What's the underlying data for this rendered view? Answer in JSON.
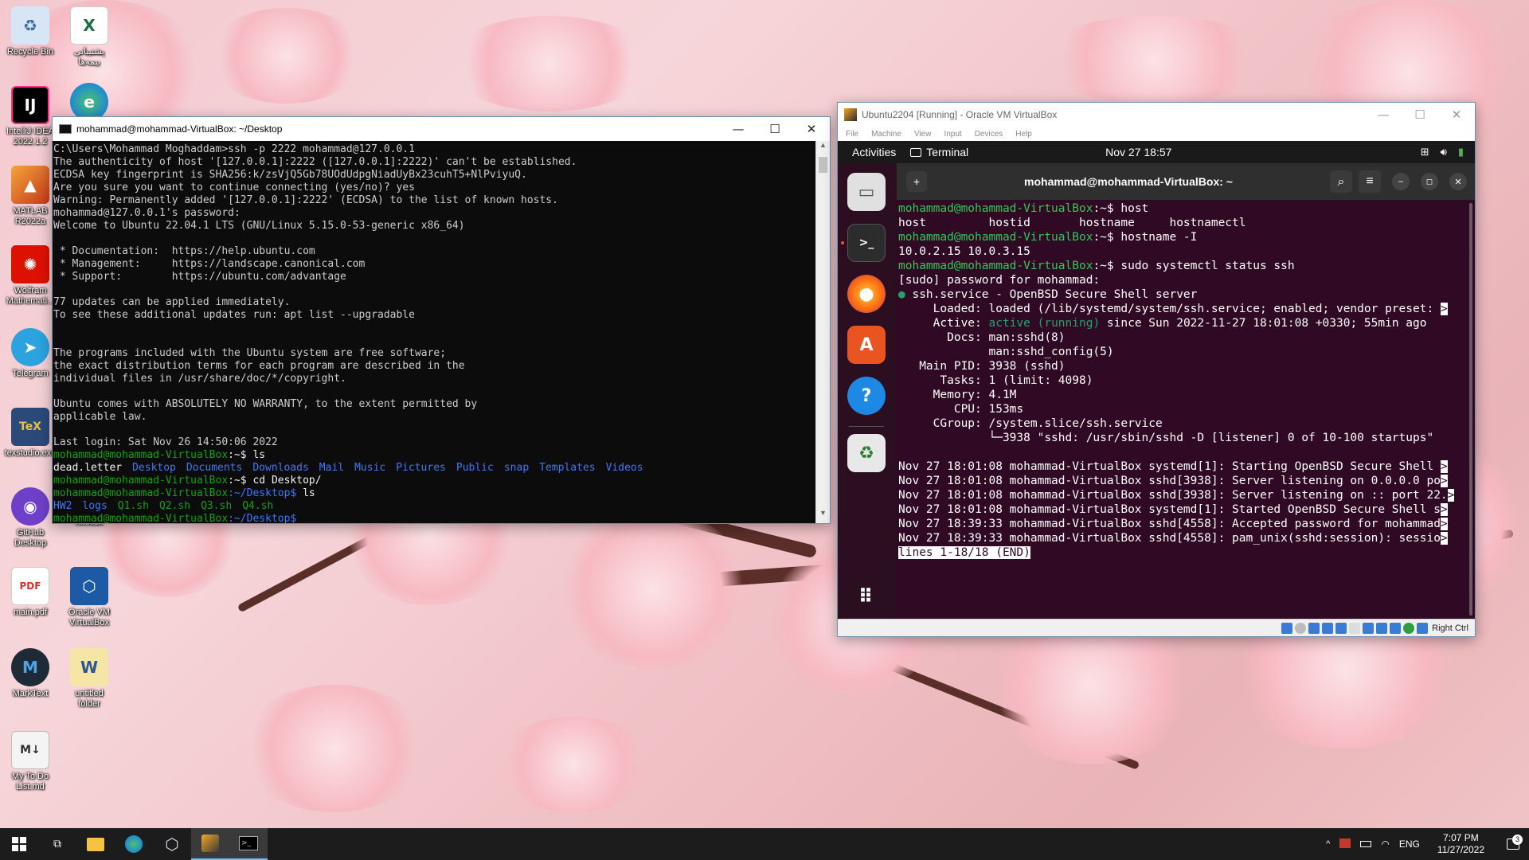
{
  "desktop": {
    "icons": [
      {
        "label": "Recycle Bin",
        "icon": "recycle-bin-icon",
        "color": "#d7e6f5"
      },
      {
        "label": "پشتیبانی\nبیمه‌ها",
        "icon": "excel-file-icon",
        "color": "#1d6f42"
      },
      {
        "label": "IntelliJ IDEA\n2022.1.2",
        "icon": "intellij-icon",
        "color": "#000000"
      },
      {
        "label": "",
        "icon": "edge-icon",
        "color": "#1f8ad2"
      },
      {
        "label": "MATLAB\nR2022a",
        "icon": "matlab-icon",
        "color": "#e16737"
      },
      {
        "label": "Wolfram\nMathemati...",
        "icon": "wolfram-icon",
        "color": "#dd1100"
      },
      {
        "label": "Telegram",
        "icon": "telegram-icon",
        "color": "#2aa3df"
      },
      {
        "label": "texstudio.exe",
        "icon": "texstudio-icon",
        "color": "#2b4a7a"
      },
      {
        "label": "GitHub\nDesktop",
        "icon": "github-desktop-icon",
        "color": "#6e40c9"
      },
      {
        "label": "nn.xlsx",
        "icon": "",
        "color": ""
      },
      {
        "label": "main.pdf",
        "icon": "pdf-file-icon",
        "color": "#ffffff"
      },
      {
        "label": "Oracle VM\nVirtualBox",
        "icon": "virtualbox-icon",
        "color": "#1c5aa6"
      },
      {
        "label": "MarkText",
        "icon": "marktext-icon",
        "color": "#1e2a36"
      },
      {
        "label": "untitled\nfolder",
        "icon": "word-file-icon",
        "color": "#f6e6a6"
      },
      {
        "label": "My To Do\nList.md",
        "icon": "markdown-file-icon",
        "color": "#f4f4f4"
      }
    ]
  },
  "cmd": {
    "title": "mohammad@mohammad-VirtualBox: ~/Desktop",
    "lines": [
      "C:\\Users\\Mohammad Moghaddam>ssh -p 2222 mohammad@127.0.0.1",
      "The authenticity of host '[127.0.0.1]:2222 ([127.0.0.1]:2222)' can't be established.",
      "ECDSA key fingerprint is SHA256:k/zsVjQ5Gb78UOdUdpgNiadUyBx23cuhT5+NlPviyuQ.",
      "Are you sure you want to continue connecting (yes/no)? yes",
      "Warning: Permanently added '[127.0.0.1]:2222' (ECDSA) to the list of known hosts.",
      "mohammad@127.0.0.1's password:",
      "Welcome to Ubuntu 22.04.1 LTS (GNU/Linux 5.15.0-53-generic x86_64)",
      "",
      " * Documentation:  https://help.ubuntu.com",
      " * Management:     https://landscape.canonical.com",
      " * Support:        https://ubuntu.com/advantage",
      "",
      "77 updates can be applied immediately.",
      "To see these additional updates run: apt list --upgradable",
      "",
      "",
      "The programs included with the Ubuntu system are free software;",
      "the exact distribution terms for each program are described in the",
      "individual files in /usr/share/doc/*/copyright.",
      "",
      "Ubuntu comes with ABSOLUTELY NO WARRANTY, to the extent permitted by",
      "applicable law.",
      "",
      "Last login: Sat Nov 26 14:50:06 2022"
    ],
    "prompt_user": "mohammad@mohammad-VirtualBox",
    "prompt_home": ":~$ ",
    "prompt_desktop": ":~/Desktop$ ",
    "cmd_ls1": "ls",
    "ls_home_file": "dead.letter",
    "ls_home_dirs": [
      "Desktop",
      "Documents",
      "Downloads",
      "Mail",
      "Music",
      "Pictures",
      "Public",
      "snap",
      "Templates",
      "Videos"
    ],
    "cmd_cd": "cd Desktop/",
    "cmd_ls2": "ls",
    "ls_desktop": [
      "HW2",
      "logs",
      "Q1.sh",
      "Q2.sh",
      "Q3.sh",
      "Q4.sh"
    ]
  },
  "vbox": {
    "title": "Ubuntu2204 [Running] - Oracle VM VirtualBox",
    "menu": [
      "File",
      "Machine",
      "View",
      "Input",
      "Devices",
      "Help"
    ],
    "status_right": "Right Ctrl",
    "ubuntu": {
      "activities": "Activities",
      "app": "Terminal",
      "clock": "Nov 27  18:57",
      "terminal_title": "mohammad@mohammad-VirtualBox: ~",
      "prompt_user": "mohammad@mohammad-VirtualBox",
      "prompt_suffix": ":~$ ",
      "cmd1": "host",
      "host_completions": "host         hostid       hostname     hostnamectl",
      "cmd2": "hostname -I",
      "ip_out": "10.0.2.15 10.0.3.15",
      "cmd3": "sudo systemctl status ssh",
      "sudo_prompt": "[sudo] password for mohammad:",
      "service_line": "ssh.service - OpenBSD Secure Shell server",
      "loaded": "     Loaded: loaded (/lib/systemd/system/ssh.service; enabled; vendor preset: ",
      "active_label": "     Active: ",
      "active_value": "active (running)",
      "active_rest": " since Sun 2022-11-27 18:01:08 +0330; 55min ago",
      "docs1": "       Docs: man:sshd(8)",
      "docs2": "             man:sshd_config(5)",
      "mainpid": "   Main PID: 3938 (sshd)",
      "tasks": "      Tasks: 1 (limit: 4098)",
      "memory": "     Memory: 4.1M",
      "cpu": "        CPU: 153ms",
      "cgroup": "     CGroup: /system.slice/ssh.service",
      "cgroup2": "             └─3938 \"sshd: /usr/sbin/sshd -D [listener] 0 of 10-100 startups\"",
      "log": [
        "Nov 27 18:01:08 mohammad-VirtualBox systemd[1]: Starting OpenBSD Secure Shell ",
        "Nov 27 18:01:08 mohammad-VirtualBox sshd[3938]: Server listening on 0.0.0.0 po",
        "Nov 27 18:01:08 mohammad-VirtualBox sshd[3938]: Server listening on :: port 22.",
        "Nov 27 18:01:08 mohammad-VirtualBox systemd[1]: Started OpenBSD Secure Shell s",
        "Nov 27 18:39:33 mohammad-VirtualBox sshd[4558]: Accepted password for mohammad",
        "Nov 27 18:39:33 mohammad-VirtualBox sshd[4558]: pam_unix(sshd:session): sessio"
      ],
      "pager": "lines 1-18/18 (END)",
      "overflow_marker": ">"
    }
  },
  "taskbar": {
    "lang": "ENG",
    "time": "7:07 PM",
    "date": "11/27/2022",
    "notif_count": "3"
  }
}
